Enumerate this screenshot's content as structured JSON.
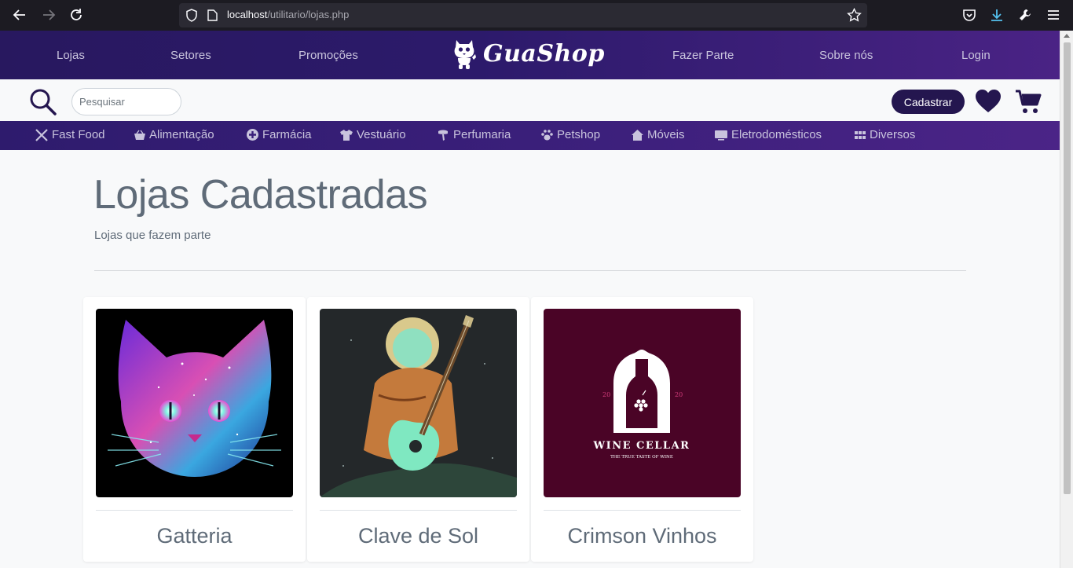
{
  "browser": {
    "url_host": "localhost",
    "url_path": "/utilitario/lojas.php"
  },
  "topnav": {
    "left_links": [
      "Lojas",
      "Setores",
      "Promoções"
    ],
    "right_links": [
      "Fazer Parte",
      "Sobre nós",
      "Login"
    ],
    "brand": "GuaShop"
  },
  "search": {
    "placeholder": "Pesquisar"
  },
  "actions": {
    "register_label": "Cadastrar"
  },
  "categories": [
    {
      "label": "Fast Food",
      "icon": "utensils-icon"
    },
    {
      "label": "Alimentação",
      "icon": "basket-icon"
    },
    {
      "label": "Farmácia",
      "icon": "medical-cross-icon"
    },
    {
      "label": "Vestuário",
      "icon": "tshirt-icon"
    },
    {
      "label": "Perfumaria",
      "icon": "spray-icon"
    },
    {
      "label": "Petshop",
      "icon": "paw-icon"
    },
    {
      "label": "Móveis",
      "icon": "home-icon"
    },
    {
      "label": "Eletrodomésticos",
      "icon": "tv-icon"
    },
    {
      "label": "Diversos",
      "icon": "grid-icon"
    }
  ],
  "main": {
    "title": "Lojas Cadastradas",
    "subtitle": "Lojas que fazem parte"
  },
  "stores": [
    {
      "name": "Gatteria",
      "image": "galaxy-cat-image"
    },
    {
      "name": "Clave de Sol",
      "image": "astronaut-guitar-image"
    },
    {
      "name": "Crimson Vinhos",
      "image": "wine-cellar-logo-image",
      "logo_text": "WINE CELLAR",
      "logo_tagline": "THE TRUE TASTE OF WINE",
      "logo_year_left": "20",
      "logo_year_right": "20"
    }
  ],
  "colors": {
    "nav_dark": "#28185f",
    "nav_purple": "#4a2385",
    "button": "#24164f",
    "wine": "#4a0426"
  }
}
